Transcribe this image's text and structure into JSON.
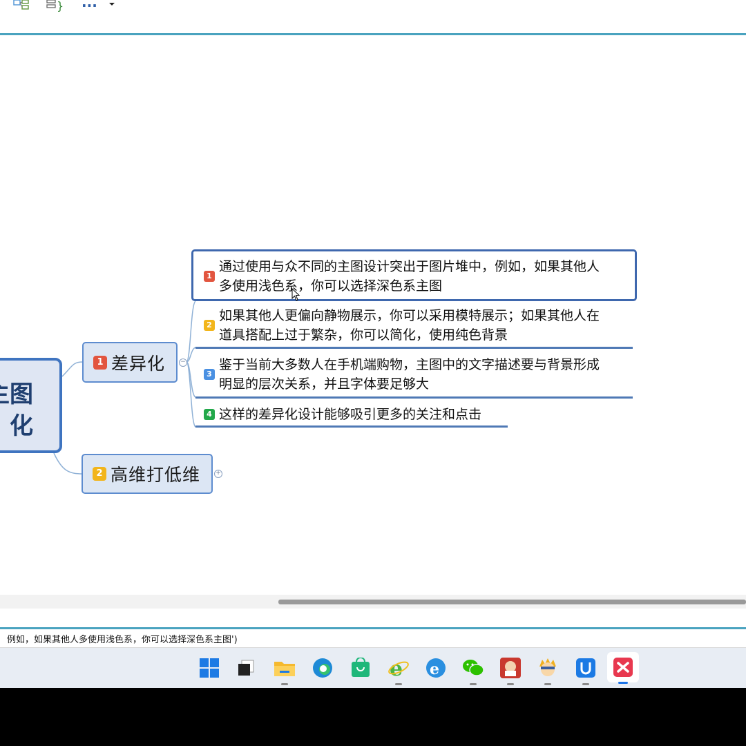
{
  "toolbar": {
    "icons": [
      "mindmap-layout-icon",
      "outline-icon",
      "more-icon",
      "dropdown-arrow-icon"
    ],
    "more_label": "···"
  },
  "central_topic": {
    "line1": "主图",
    "line2": "化"
  },
  "branches": [
    {
      "priority": "1",
      "label": "差异化",
      "collapse_symbol": "−",
      "subtopics": [
        {
          "priority": "1",
          "line1": "通过使用与众不同的主图设计突出于图片堆中，例如，如果其他人",
          "line2": "多使用浅色系，你可以选择深色系主图"
        },
        {
          "priority": "2",
          "line1": "如果其他人更偏向静物展示，你可以采用模特展示；如果其他人在",
          "line2": "道具搭配上过于繁杂，你可以简化，使用纯色背景"
        },
        {
          "priority": "3",
          "line1": "鉴于当前大多数人在手机端购物，主图中的文字描述要与背景形成",
          "line2": "明显的层次关系，并且字体要足够大"
        },
        {
          "priority": "4",
          "line1": "这样的差异化设计能够吸引更多的关注和点击",
          "line2": ""
        }
      ]
    },
    {
      "priority": "2",
      "label": "高维打低维",
      "collapse_symbol": "+"
    }
  ],
  "status_bar": {
    "text": "例如，如果其他人多使用浅色系，你可以选择深色系主图')"
  },
  "taskbar": {
    "apps": [
      "start-icon",
      "task-view-icon",
      "file-explorer-icon",
      "edge-icon",
      "store-icon",
      "ie-green-icon",
      "ie-blue-icon",
      "wechat-icon",
      "app-red-icon",
      "app-avatar-icon",
      "app-blue-icon",
      "xmind-icon"
    ]
  },
  "colors": {
    "accent": "#4aa3bf",
    "node_border": "#3f74c0",
    "priority_red": "#e2553f",
    "priority_yellow": "#f2b51b",
    "priority_blue": "#4a90e2",
    "priority_green": "#22a84a"
  }
}
